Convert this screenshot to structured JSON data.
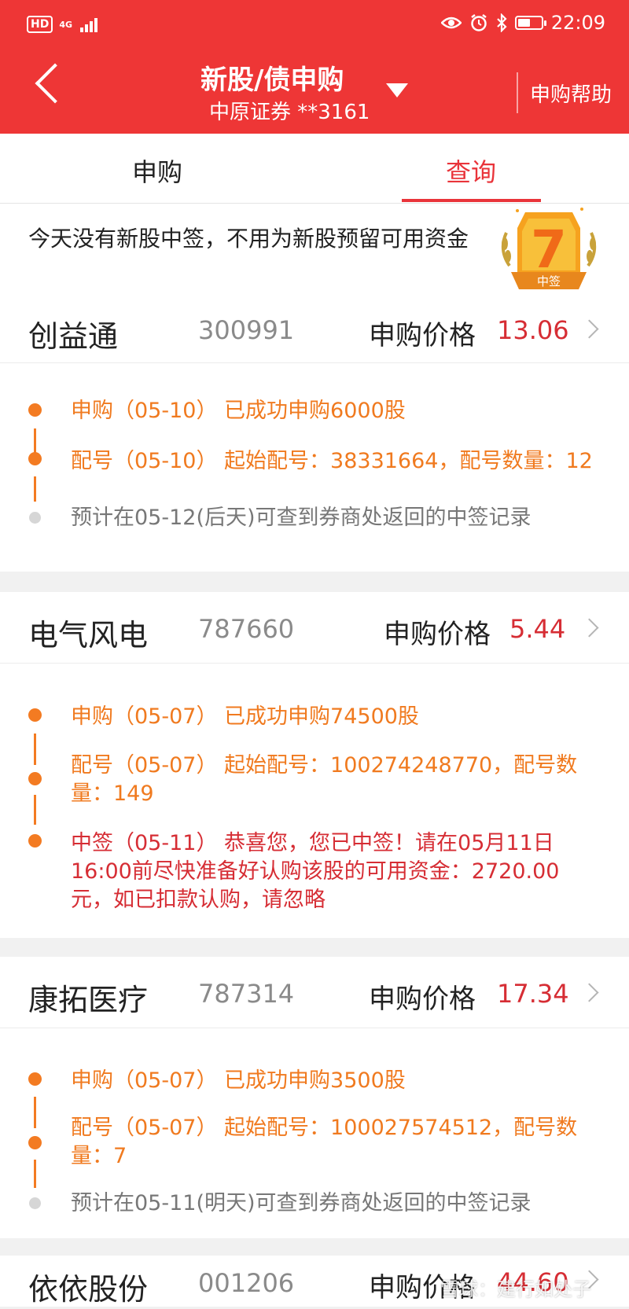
{
  "status_bar": {
    "hd": "HD",
    "network": "4G",
    "time": "22:09",
    "battery_level": 0.55
  },
  "header": {
    "title": "新股/债申购",
    "subtitle": "中原证券 **3161",
    "help": "申购帮助"
  },
  "tabs": [
    {
      "label": "申购"
    },
    {
      "label": "查询"
    }
  ],
  "notice": {
    "text": "今天没有新股中签，不用为新股预留可用资金",
    "badge_label": "中签",
    "badge_number": "7"
  },
  "price_label": "申购价格",
  "stocks": [
    {
      "name": "创益通",
      "code": "300991",
      "price": "13.06",
      "events": [
        {
          "text": "申购（05-10） 已成功申购6000股"
        },
        {
          "text": "配号（05-10） 起始配号：38331664，配号数量：12"
        },
        {
          "text": "预计在05-12(后天)可查到券商处返回的中签记录"
        }
      ]
    },
    {
      "name": "电气风电",
      "code": "787660",
      "price": "5.44",
      "events": [
        {
          "text": "申购（05-07） 已成功申购74500股"
        },
        {
          "text": "配号（05-07） 起始配号：100274248770，配号数量：149"
        },
        {
          "text": "中签（05-11） 恭喜您，您已中签！请在05月11日16:00前尽快准备好认购该股的可用资金：2720.00元，如已扣款认购，请忽略"
        }
      ]
    },
    {
      "name": "康拓医疗",
      "code": "787314",
      "price": "17.34",
      "events": [
        {
          "text": "申购（05-07） 已成功申购3500股"
        },
        {
          "text": "配号（05-07） 起始配号：100027574512，配号数量：7"
        },
        {
          "text": "预计在05-11(明天)可查到券商处返回的中签记录"
        }
      ]
    },
    {
      "name": "依依股份",
      "code": "001206",
      "price": "44.60"
    }
  ],
  "watermark": "雪球：建行如处子",
  "colors": {
    "header": "#ee3636",
    "accent": "#e9343a",
    "event_orange": "#f07a1f",
    "event_red": "#d62d34"
  }
}
